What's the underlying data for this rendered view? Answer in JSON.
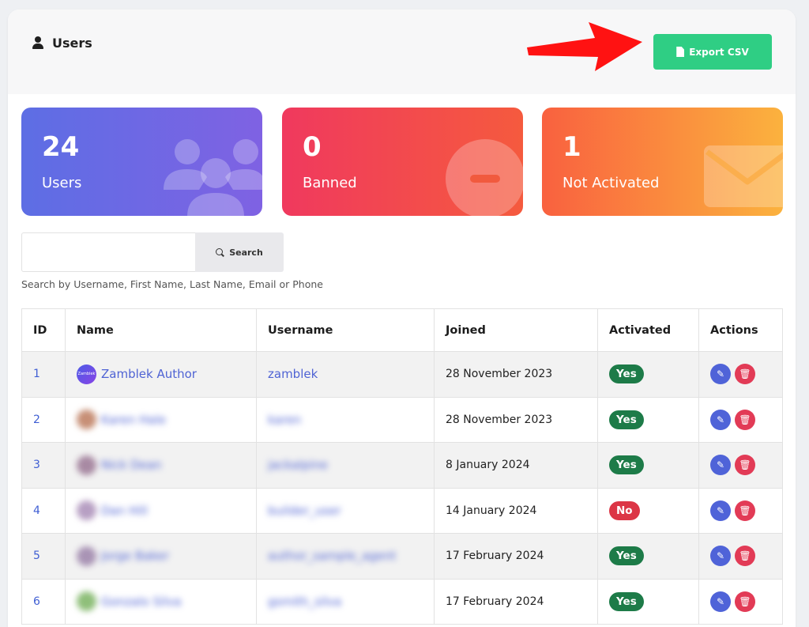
{
  "header": {
    "title": "Users",
    "export_label": "Export CSV"
  },
  "stats": [
    {
      "value": "24",
      "label": "Users",
      "icon": "users-group-icon"
    },
    {
      "value": "0",
      "label": "Banned",
      "icon": "minus-circle-icon"
    },
    {
      "value": "1",
      "label": "Not Activated",
      "icon": "envelope-icon"
    }
  ],
  "search": {
    "placeholder": "",
    "button_label": "Search",
    "hint": "Search by Username, First Name, Last Name, Email or Phone"
  },
  "table": {
    "columns": [
      "ID",
      "Name",
      "Username",
      "Joined",
      "Activated",
      "Actions"
    ],
    "rows": [
      {
        "id": "1",
        "name": "Zamblek Author",
        "username": "zamblek",
        "joined": "28 November 2023",
        "activated": "Yes",
        "avatar_text": "Zamblek",
        "avatar_color": "#5a4fe3"
      },
      {
        "id": "2",
        "name": "Karen Hale",
        "username": "karen",
        "joined": "28 November 2023",
        "activated": "Yes",
        "avatar_color": "#c78f76"
      },
      {
        "id": "3",
        "name": "Nick Dean",
        "username": "jackalpine",
        "joined": "8 January 2024",
        "activated": "Yes",
        "avatar_color": "#a88aa3"
      },
      {
        "id": "4",
        "name": "Dan Hill",
        "username": "builder_user",
        "joined": "14 January 2024",
        "activated": "No",
        "avatar_color": "#b79fc3"
      },
      {
        "id": "5",
        "name": "Jorge Baker",
        "username": "author_sample_agent",
        "joined": "17 February 2024",
        "activated": "Yes",
        "avatar_color": "#a994b5"
      },
      {
        "id": "6",
        "name": "Gonzalo Silva",
        "username": "gsmith_silva",
        "joined": "17 February 2024",
        "activated": "Yes",
        "avatar_color": "#8fbf7a"
      }
    ]
  },
  "colors": {
    "export_green": "#2fce84",
    "yes_green": "#1d7b48",
    "no_red": "#dc3545",
    "edit_blue": "#4f63d8",
    "delete_red": "#e23b56",
    "arrow_red": "#ff1212"
  }
}
